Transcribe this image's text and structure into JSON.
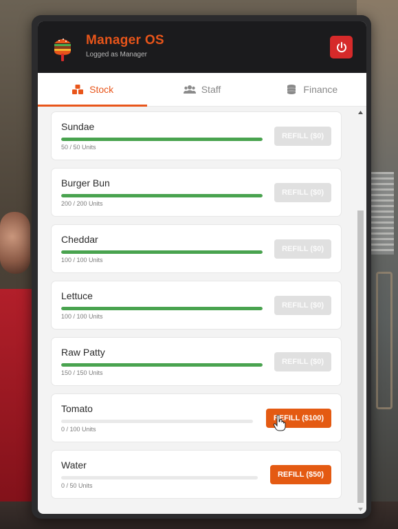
{
  "app": {
    "title": "Manager OS",
    "subtitle": "Logged as Manager",
    "logo_icon": "burger-logo-icon",
    "power_icon": "power-icon"
  },
  "tabs": [
    {
      "label": "Stock",
      "icon": "boxes-icon",
      "active": true
    },
    {
      "label": "Staff",
      "icon": "users-icon",
      "active": false
    },
    {
      "label": "Finance",
      "icon": "coins-icon",
      "active": false
    }
  ],
  "items": [
    {
      "name": "Sundae",
      "units": "50 / 50 Units",
      "fill": 1.0,
      "refill": "REFILL ($0)",
      "enabled": false
    },
    {
      "name": "Burger Bun",
      "units": "200 / 200 Units",
      "fill": 1.0,
      "refill": "REFILL ($0)",
      "enabled": false
    },
    {
      "name": "Cheddar",
      "units": "100 / 100 Units",
      "fill": 1.0,
      "refill": "REFILL ($0)",
      "enabled": false
    },
    {
      "name": "Lettuce",
      "units": "100 / 100 Units",
      "fill": 1.0,
      "refill": "REFILL ($0)",
      "enabled": false
    },
    {
      "name": "Raw Patty",
      "units": "150 / 150 Units",
      "fill": 1.0,
      "refill": "REFILL ($0)",
      "enabled": false
    },
    {
      "name": "Tomato",
      "units": "0 / 100 Units",
      "fill": 0.0,
      "refill": "REFILL ($100)",
      "enabled": true
    },
    {
      "name": "Water",
      "units": "0 / 50 Units",
      "fill": 0.0,
      "refill": "REFILL ($50)",
      "enabled": true
    }
  ],
  "colors": {
    "accent": "#e8551a",
    "progress": "#49a34f",
    "power": "#d62a2a",
    "header_bg": "#1b1b1d"
  }
}
